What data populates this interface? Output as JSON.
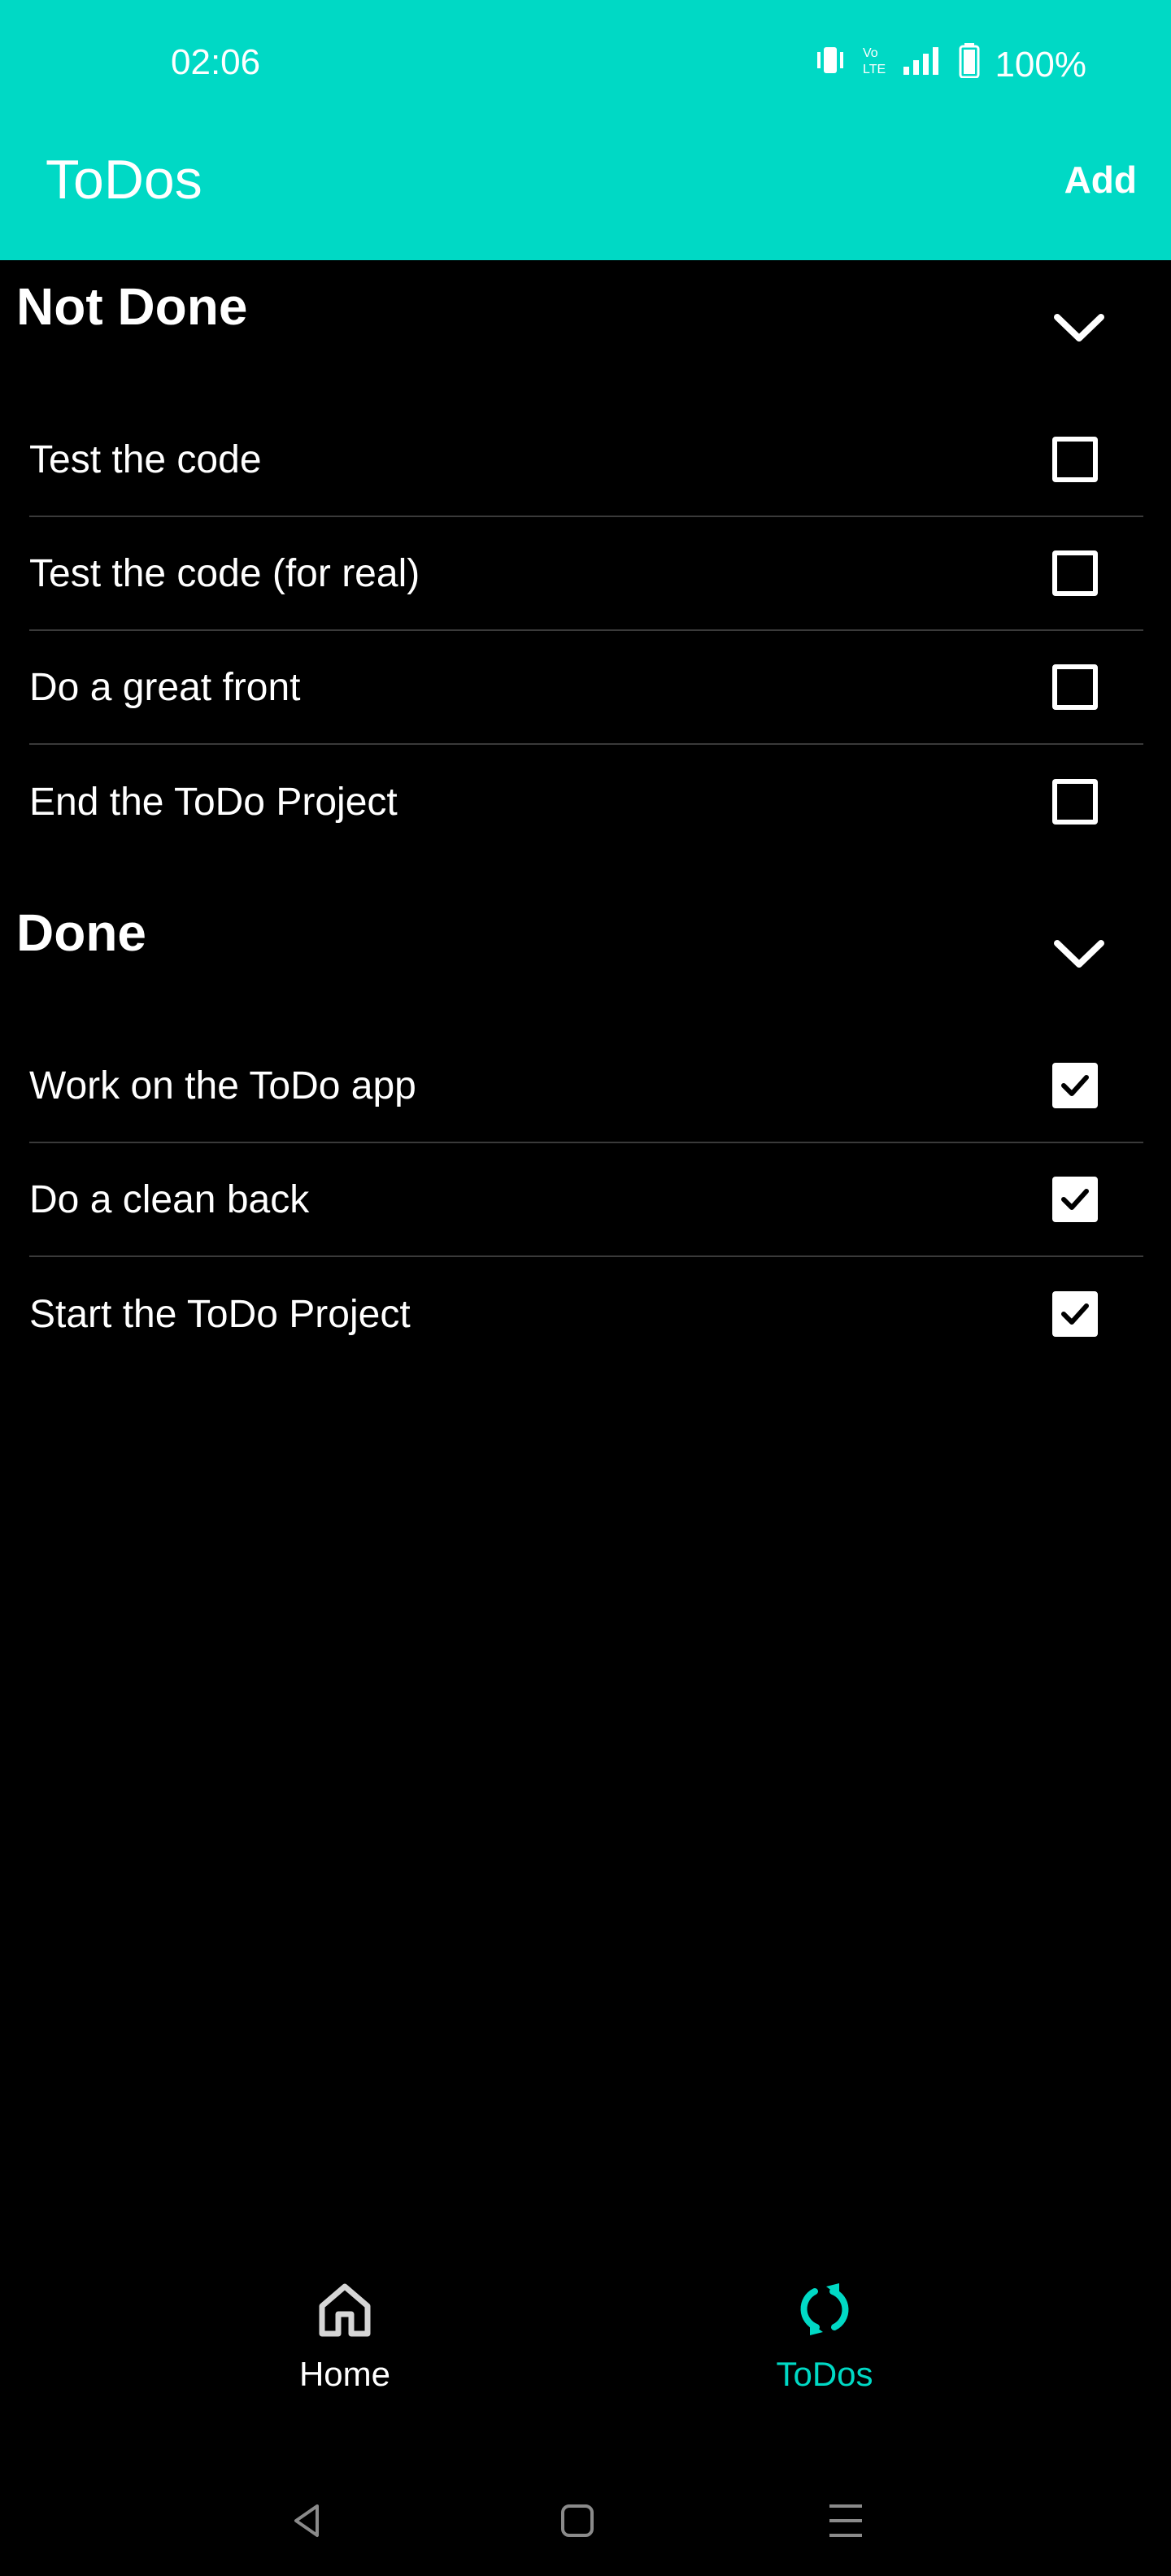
{
  "status_bar": {
    "time": "02:06",
    "battery": "100%",
    "icons": [
      "vibrate-icon",
      "volte-icon",
      "signal-icon",
      "battery-icon"
    ]
  },
  "app_bar": {
    "title": "ToDos",
    "add_label": "Add",
    "color": "#00D9C5"
  },
  "sections": [
    {
      "title": "Not Done",
      "items": [
        {
          "label": "Test the code",
          "checked": false
        },
        {
          "label": "Test the code (for real)",
          "checked": false
        },
        {
          "label": "Do a great front",
          "checked": false
        },
        {
          "label": "End the ToDo Project",
          "checked": false
        }
      ]
    },
    {
      "title": "Done",
      "items": [
        {
          "label": "Work on the ToDo app",
          "checked": true
        },
        {
          "label": "Do a clean back",
          "checked": true
        },
        {
          "label": "Start the ToDo Project",
          "checked": true
        }
      ]
    }
  ],
  "bottom_nav": [
    {
      "label": "Home",
      "icon": "home-icon",
      "active": false
    },
    {
      "label": "ToDos",
      "icon": "sync-icon",
      "active": true
    }
  ],
  "colors": {
    "accent": "#00D9C5",
    "background": "#000000",
    "text": "#FFFFFF",
    "divider": "#3A3A3A"
  }
}
